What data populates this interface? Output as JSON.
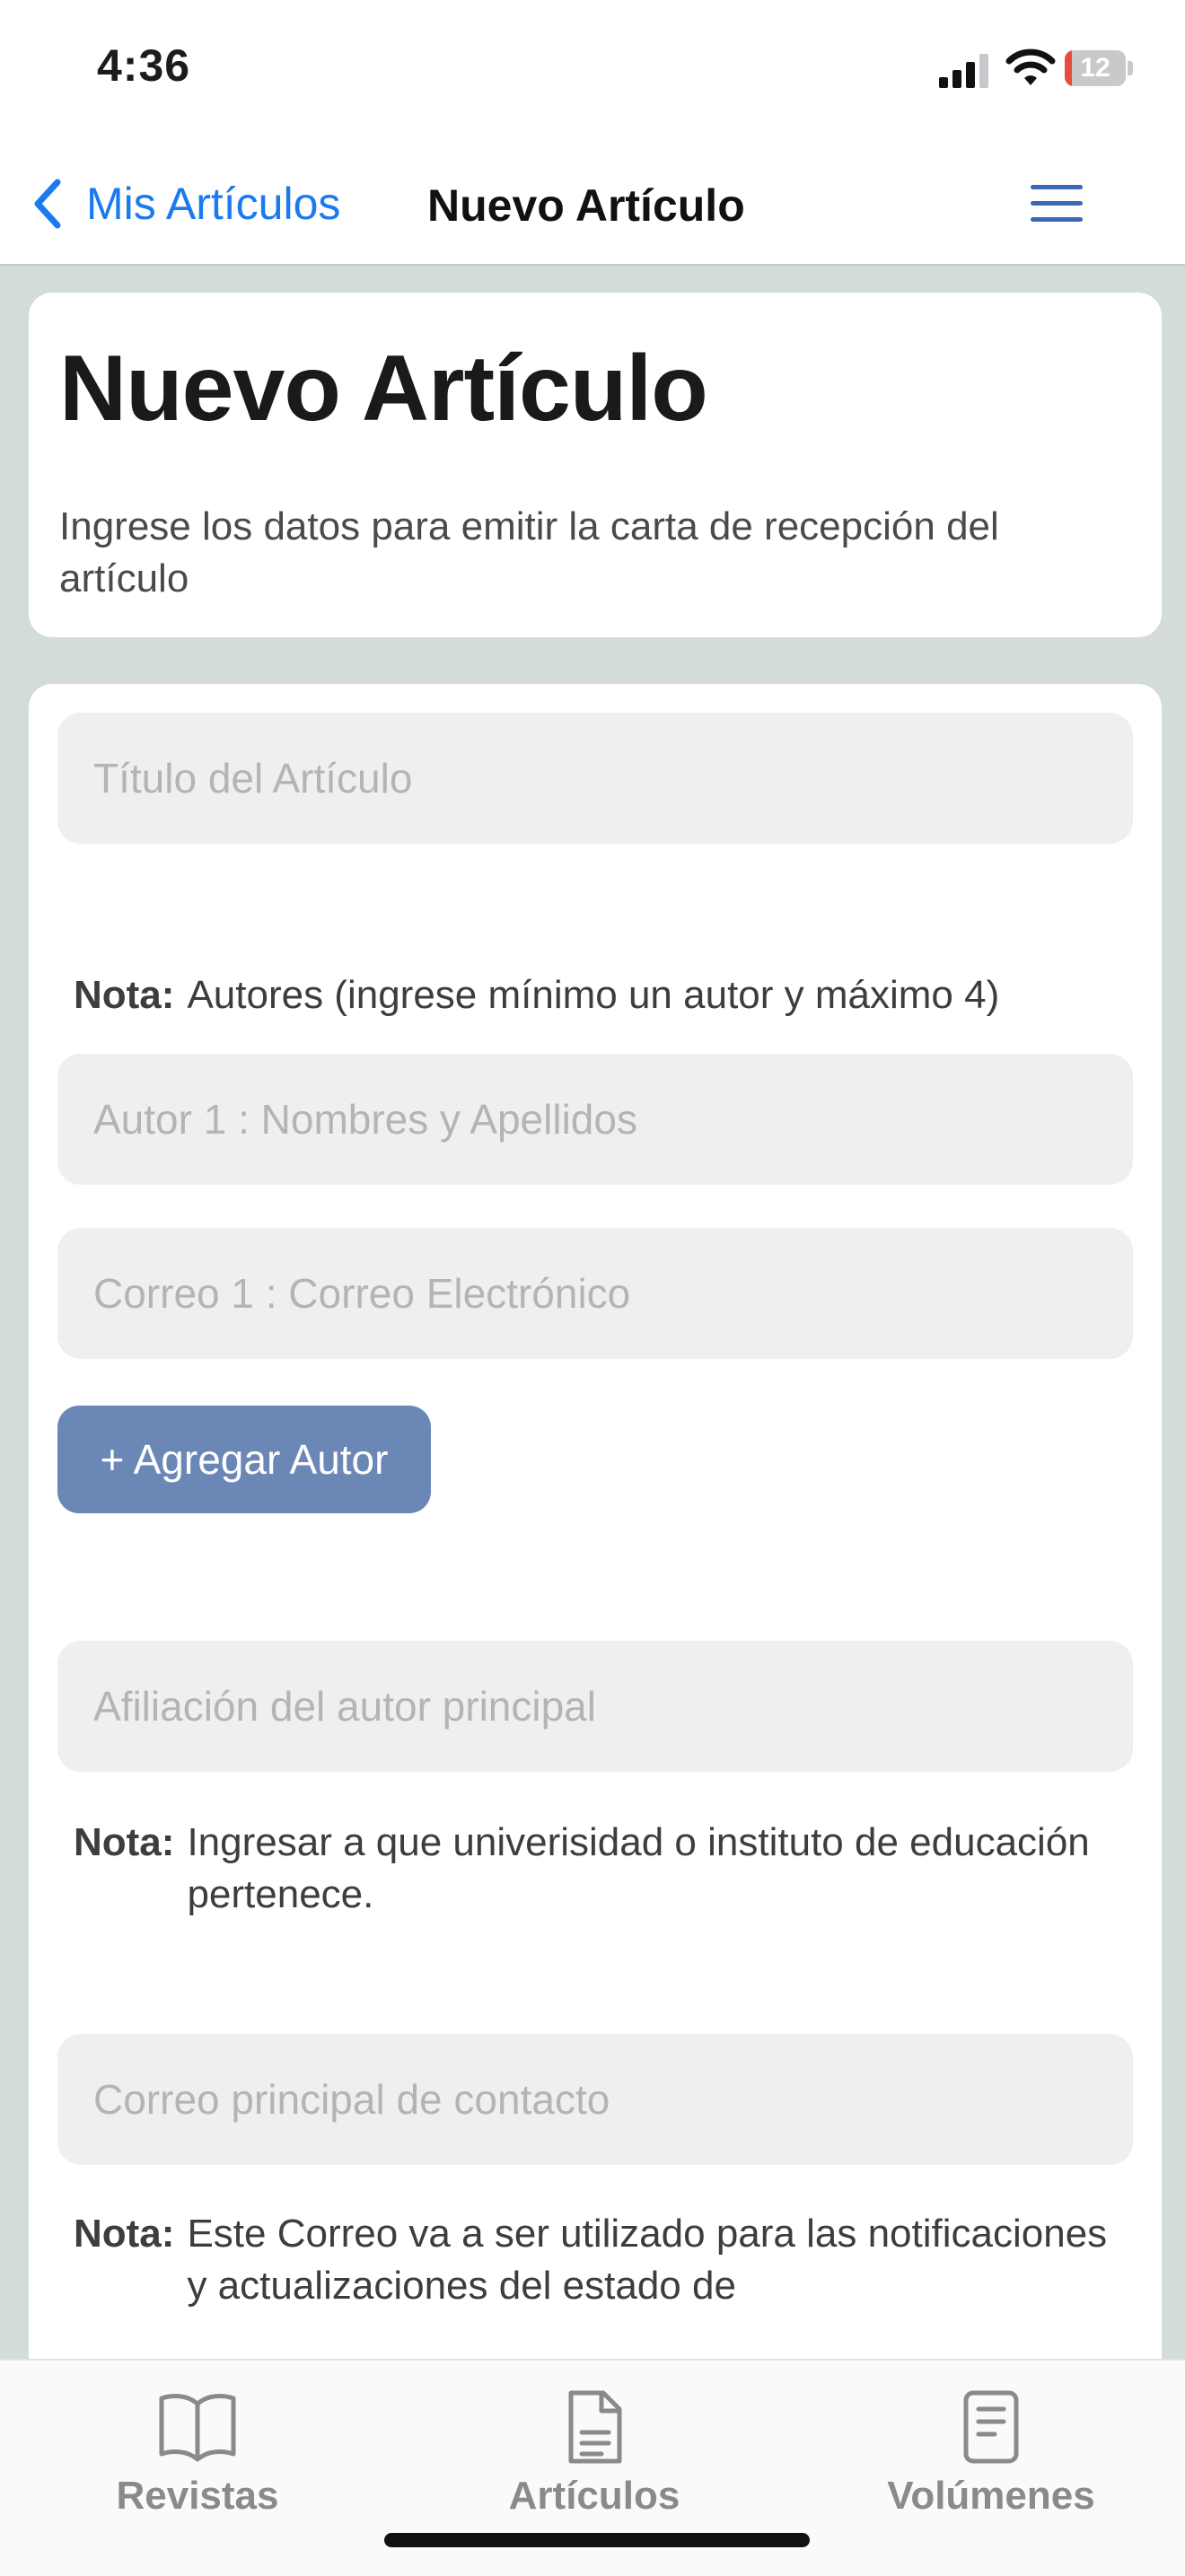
{
  "status_bar": {
    "time": "4:36",
    "battery_level": "12",
    "battery_fraction": 0.12,
    "battery_color": "#e74c3c"
  },
  "nav": {
    "back_label": "Mis Artículos",
    "title": "Nuevo Artículo"
  },
  "header": {
    "title": "Nuevo Artículo",
    "subtitle": "Ingrese los datos para emitir la carta de recepción del artículo"
  },
  "form": {
    "title_placeholder": "Título del Artículo",
    "authors_note": {
      "label": "Nota:",
      "text": "Autores (ingrese mínimo un autor y máximo 4)"
    },
    "author1_placeholder": "Autor 1 : Nombres y Apellidos",
    "email1_placeholder": "Correo 1 : Correo Electrónico",
    "add_author_label": "+ Agregar Autor",
    "affiliation_placeholder": "Afiliación del autor principal",
    "affiliation_note": {
      "label": "Nota:",
      "text": "Ingresar a que univerisidad o instituto de educación pertenece."
    },
    "contact_email_placeholder": "Correo principal de contacto",
    "contact_note": {
      "label": "Nota:",
      "text": "Este Correo va a ser utilizado para las notificaciones y actualizaciones del estado de"
    }
  },
  "tabs": [
    {
      "label": "Revistas",
      "icon": "book-icon"
    },
    {
      "label": "Artículos",
      "icon": "document-icon"
    },
    {
      "label": "Volúmenes",
      "icon": "list-document-icon"
    }
  ],
  "colors": {
    "accent": "#1a7af0",
    "button": "#6b87b6",
    "background": "#d3dcdb",
    "menu": "#3b67b5"
  }
}
